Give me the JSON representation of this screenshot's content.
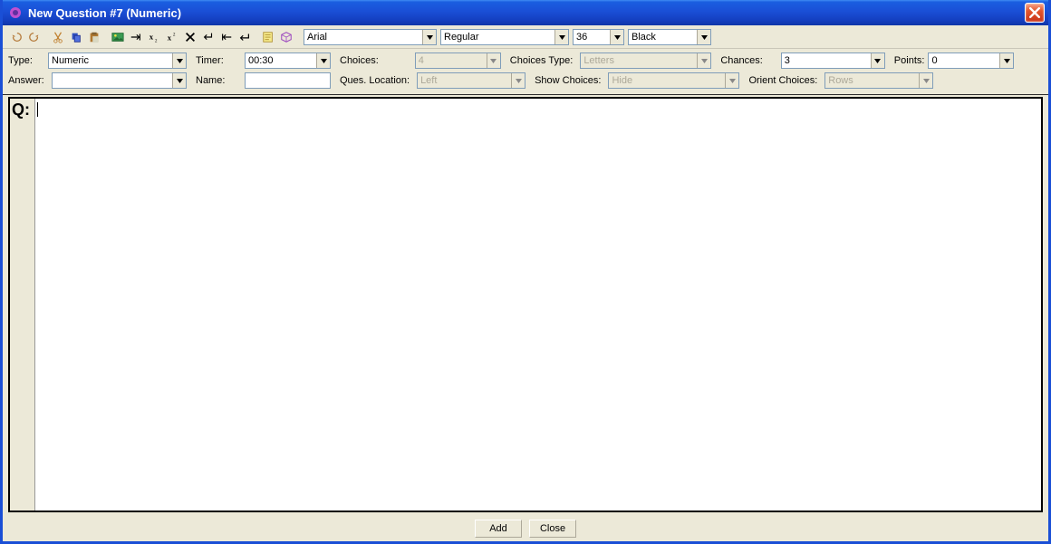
{
  "title": "New Question #7 (Numeric)",
  "toolbar": {
    "font_family": "Arial",
    "font_style": "Regular",
    "font_size": "36",
    "font_color": "Black"
  },
  "props": {
    "row1": {
      "type_label": "Type:",
      "type_value": "Numeric",
      "timer_label": "Timer:",
      "timer_value": "00:30",
      "choices_label": "Choices:",
      "choices_value": "4",
      "choices_type_label": "Choices Type:",
      "choices_type_value": "Letters",
      "chances_label": "Chances:",
      "chances_value": "3",
      "points_label": "Points:",
      "points_value": "0"
    },
    "row2": {
      "answer_label": "Answer:",
      "answer_value": "",
      "name_label": "Name:",
      "name_value": "",
      "ques_loc_label": "Ques. Location:",
      "ques_loc_value": "Left",
      "show_choices_label": "Show Choices:",
      "show_choices_value": "Hide",
      "orient_choices_label": "Orient Choices:",
      "orient_choices_value": "Rows"
    }
  },
  "editor": {
    "gutter_label": "Q:"
  },
  "footer": {
    "add_label": "Add",
    "close_label": "Close"
  }
}
